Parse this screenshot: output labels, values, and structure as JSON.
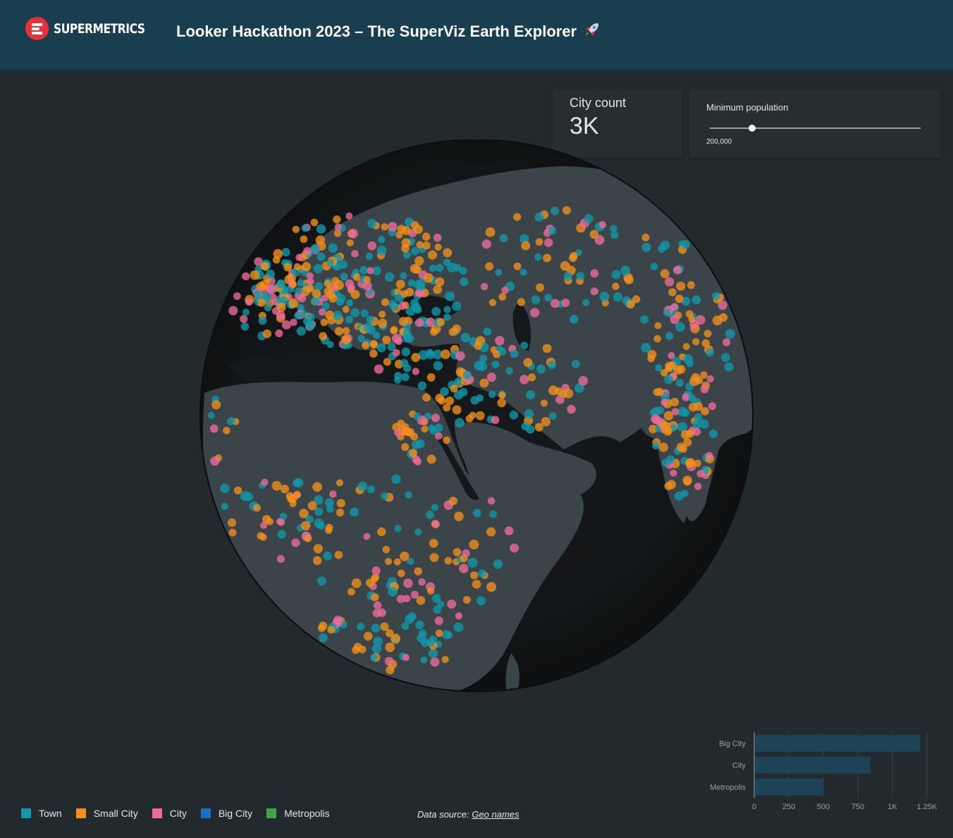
{
  "header": {
    "logo_text": "SUPERMETRICS",
    "title": "Looker Hackathon 2023 – The SuperViz Earth Explorer"
  },
  "kpi": {
    "label": "City count",
    "value": "3K"
  },
  "filter": {
    "label": "Minimum population",
    "value_text": "200,000",
    "fraction": 0.2
  },
  "colors": {
    "town": "#1199aa",
    "small_city": "#f39019",
    "city": "#f06a9a",
    "big_city": "#1e6fc8",
    "metropolis": "#3fa34d",
    "bar": "#1d4456"
  },
  "legend": [
    {
      "label": "Town",
      "color": "#1199aa"
    },
    {
      "label": "Small City",
      "color": "#f39019"
    },
    {
      "label": "City",
      "color": "#f06a9a"
    },
    {
      "label": "Big City",
      "color": "#1e6fc8"
    },
    {
      "label": "Metropolis",
      "color": "#3fa34d"
    }
  ],
  "source": {
    "prefix": "Data source:",
    "link_text": "Geo names"
  },
  "chart_data": {
    "type": "bar",
    "orientation": "horizontal",
    "categories": [
      "Big City",
      "City",
      "Metropolis"
    ],
    "values": [
      1200,
      840,
      495
    ],
    "xlim": [
      0,
      1250
    ],
    "x_ticks": [
      "0",
      "250",
      "500",
      "750",
      "1K",
      "1.25K"
    ],
    "grid": true
  }
}
